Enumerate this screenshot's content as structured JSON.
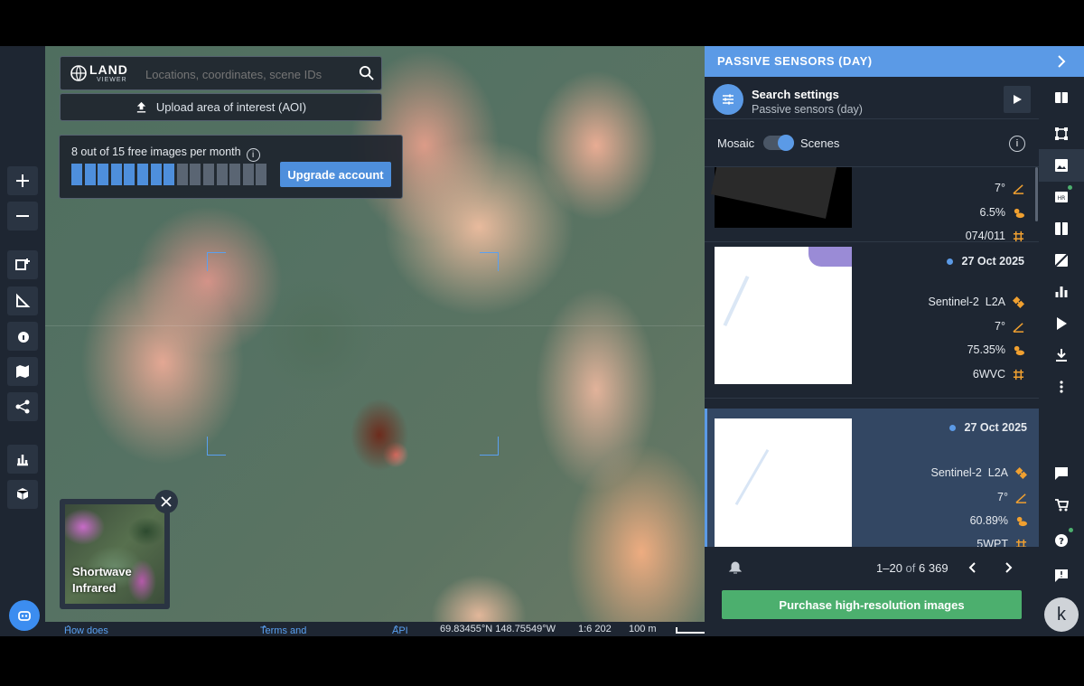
{
  "search": {
    "placeholder": "Locations, coordinates, scene IDs",
    "logo_text": "LAND",
    "logo_sub": "VIEWER"
  },
  "upload": {
    "label": "Upload area of interest (AOI)"
  },
  "quota": {
    "text": "8 out of 15 free images per month",
    "used": 8,
    "total": 15,
    "upgrade_label": "Upgrade account"
  },
  "layer": {
    "name_line1": "Shortwave",
    "name_line2": "Infrared"
  },
  "status_bar": {
    "help_link": "How does EOSDA LandViewer work?",
    "terms_link": "Terms and Conditions",
    "api_link": "API",
    "coords": "69.83455°N 148.75549°W",
    "scale": "1:6 202",
    "scale_bar": "100 m"
  },
  "panel": {
    "header": "PASSIVE SENSORS (DAY)",
    "settings_title": "Search settings",
    "settings_sub": "Passive sensors (day)",
    "mode_left": "Mosaic",
    "mode_right": "Scenes",
    "results": [
      {
        "date": "",
        "sensor": "",
        "angle": "7°",
        "cloud": "6.5%",
        "tile": "074/011"
      },
      {
        "date": "27 Oct 2025",
        "sensor": "Sentinel-2  L2A",
        "angle": "7°",
        "cloud": "75.35%",
        "tile": "6WVC"
      },
      {
        "date": "27 Oct 2025",
        "sensor": "Sentinel-2  L2A",
        "angle": "7°",
        "cloud": "60.89%",
        "tile": "5WPT"
      }
    ],
    "pager_range": "1–20",
    "pager_of": "of",
    "pager_total": "6 369",
    "buy_label": "Purchase high-resolution images"
  },
  "user": {
    "initial": "k"
  },
  "colors": {
    "accent": "#5b9ae6",
    "buy": "#4caf6e",
    "bg": "#1e2632"
  }
}
